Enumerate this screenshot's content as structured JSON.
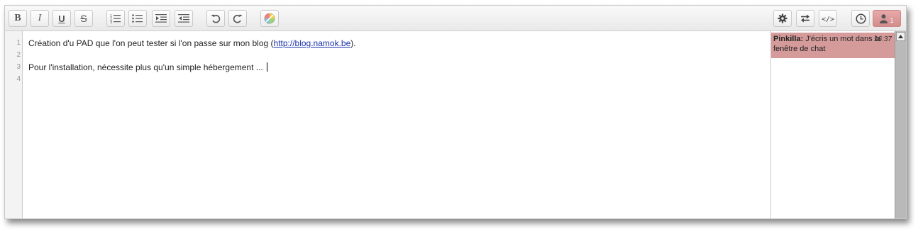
{
  "toolbar": {
    "bold_label": "B",
    "italic_label": "I",
    "underline_label": "U",
    "strike_label": "S",
    "user_count": "1"
  },
  "editor": {
    "line_numbers": [
      "1",
      "2",
      "3",
      "4"
    ],
    "line1_text": "Création d'u PAD que l'on peut tester si l'on passe sur mon blog (",
    "line1_link": "http://blog.namok.be",
    "line1_after": ").",
    "line3_text": "Pour l'installation, nécessite plus qu'un simple hébergement ..."
  },
  "chat": {
    "author": "Pinkilla:",
    "message": "J'écris un mot dans la fenêtre de chat",
    "time": "16:37"
  },
  "colors": {
    "chat_highlight": "#d59a9a",
    "user_button": "#d38c8c",
    "link": "#1a33aa"
  }
}
